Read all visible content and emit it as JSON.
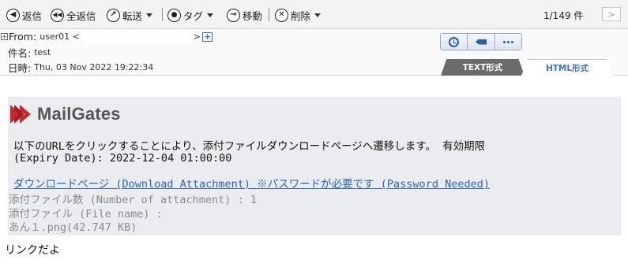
{
  "toolbar": {
    "reply_label": "返信",
    "reply_all_label": "全返信",
    "forward_label": "転送",
    "tag_label": "タグ",
    "move_label": "移動",
    "delete_label": "削除",
    "page_count": "1/149 件",
    "next_glyph": ">"
  },
  "header": {
    "from_label": "From:",
    "from_value": "user01 <",
    "from_close": ">",
    "subject_label": "件名:",
    "subject_value": "test",
    "date_label": "日時:",
    "date_value": "Thu, 03 Nov 2022 19:22:34",
    "tab_text": "TEXT形式",
    "tab_html": "HTML形式"
  },
  "body": {
    "logo_name": "MailGates",
    "message_line1": "以下のURLをクリックすることにより、添付ファイルダウンロードページへ遷移します。 有効期限",
    "message_line2": "(Expiry Date): 2022-12-04 01:00:00",
    "download_link": "ダウンロードページ (Download Attachment) ※パスワードが必要です (Password Needed)",
    "attach_count": "添付ファイル数 (Number of attachment) : 1",
    "attach_name_label": "添付ファイル (File name) :",
    "attach_file": "あん１.png(42.747 KB)",
    "footer_text": "リンクだよ"
  },
  "colors": {
    "accent_blue": "#2e5aa8",
    "link_blue": "#2a63c7",
    "logo_red": "#c8282d",
    "active_tab": "#3b73c4"
  }
}
